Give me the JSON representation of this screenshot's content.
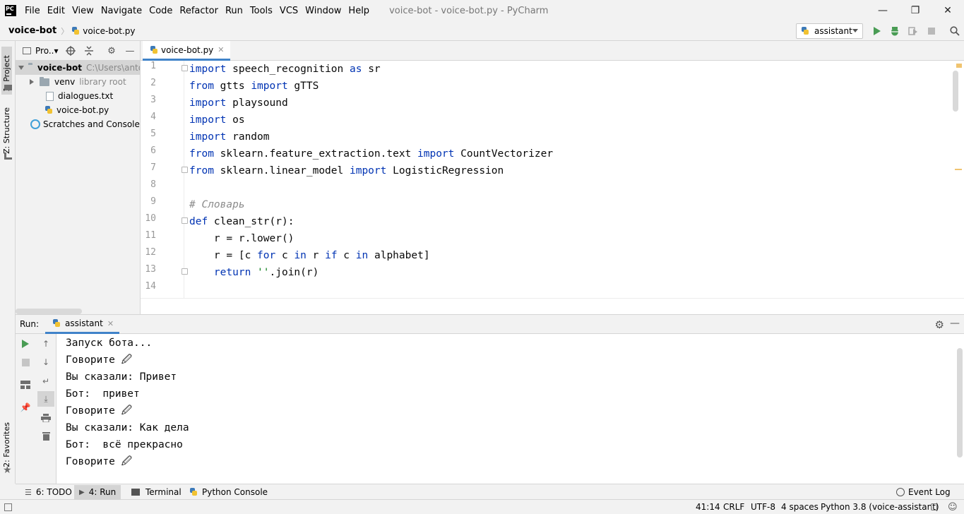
{
  "window": {
    "logo": "PC",
    "title": "voice-bot - voice-bot.py - PyCharm",
    "minimize": "—",
    "restore": "❐",
    "close": "✕"
  },
  "menu": [
    "File",
    "Edit",
    "View",
    "Navigate",
    "Code",
    "Refactor",
    "Run",
    "Tools",
    "VCS",
    "Window",
    "Help"
  ],
  "breadcrumb": {
    "project": "voice-bot",
    "file": "voice-bot.py"
  },
  "run_config": {
    "name": "assistant"
  },
  "left_strip": {
    "project": "1: Project",
    "structure": "Z: Structure",
    "favorites": "2: Favorites"
  },
  "project_panel": {
    "header": "Pro..▾",
    "tree": {
      "root_name": "voice-bot",
      "root_path": "C:\\Users\\anton",
      "venv_name": "venv",
      "venv_note": "library root",
      "file1": "dialogues.txt",
      "file2": "voice-bot.py",
      "scratches": "Scratches and Consoles"
    }
  },
  "editor": {
    "tab": "voice-bot.py",
    "line_numbers": [
      "1",
      "2",
      "3",
      "4",
      "5",
      "6",
      "7",
      "8",
      "9",
      "10",
      "11",
      "12",
      "13",
      "14"
    ]
  },
  "run_panel": {
    "label": "Run:",
    "tab": "assistant",
    "output": [
      "Запуск бота...",
      "Говорите 🖉",
      "Вы сказали: Привет",
      "Бот:  привет",
      "Говорите 🖉",
      "Вы сказали: Как дела",
      "Бот:  всё прекрасно",
      "Говорите 🖉"
    ]
  },
  "bottom_tabs": {
    "todo": "6: TODO",
    "run": "4: Run",
    "terminal": "Terminal",
    "python_console": "Python Console",
    "event_log": "Event Log"
  },
  "status": {
    "position": "41:14",
    "line_sep": "CRLF",
    "encoding": "UTF-8",
    "indent": "4 spaces",
    "interpreter": "Python 3.8 (voice-assistant)"
  },
  "colors": {
    "keyword": "#0033b3",
    "comment": "#8c8c8c",
    "string": "#067d17",
    "accent": "#4083c9",
    "run_green": "#499c54"
  }
}
